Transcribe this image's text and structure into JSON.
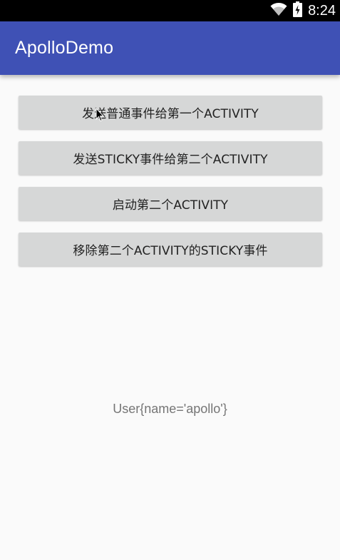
{
  "status_bar": {
    "time": "8:24",
    "icons": [
      "wifi-icon",
      "battery-charging-icon"
    ]
  },
  "app_bar": {
    "title": "ApolloDemo",
    "color": "#3f51b5"
  },
  "buttons": [
    {
      "label": "发送普通事件给第一个ACTIVITY"
    },
    {
      "label": "发送STICKY事件给第二个ACTIVITY"
    },
    {
      "label": "启动第二个ACTIVITY"
    },
    {
      "label": "移除第二个ACTIVITY的STICKY事件"
    }
  ],
  "result": {
    "text": "User{name='apollo'}"
  }
}
